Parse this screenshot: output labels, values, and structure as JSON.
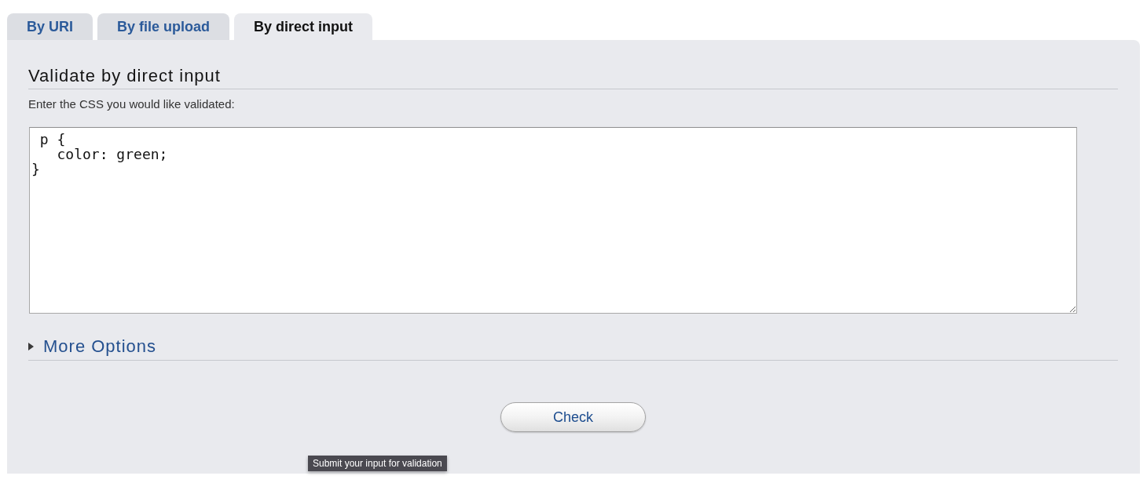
{
  "tabs": [
    {
      "label": "By URI",
      "selected": false
    },
    {
      "label": "By file upload",
      "selected": false
    },
    {
      "label": "By direct input",
      "selected": true
    }
  ],
  "section": {
    "heading": "Validate by direct input",
    "prompt": "Enter the CSS you would like validated:",
    "css_input": {
      "value": " p {\n   color: green;\n}"
    }
  },
  "more_options": {
    "label": "More Options",
    "expanded": false
  },
  "check_button": {
    "label": "Check"
  },
  "tooltip": {
    "text": "Submit your input for validation"
  }
}
